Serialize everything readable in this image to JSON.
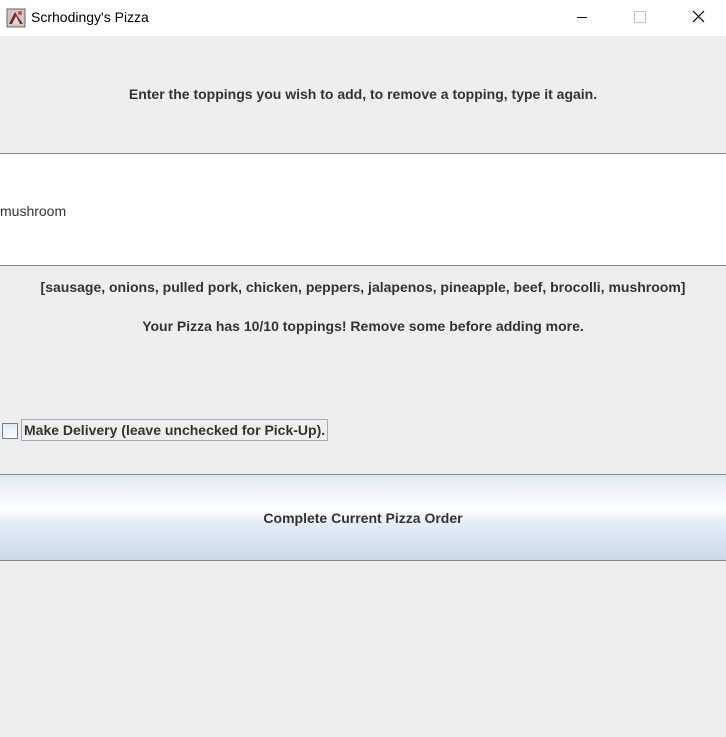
{
  "window": {
    "title": "Scrhodingy's Pizza",
    "controls": {
      "minimize": "minimize-icon",
      "maximize": "maximize-icon",
      "close": "close-icon"
    }
  },
  "instructions": "Enter the toppings you wish to add, to remove a topping, type it again.",
  "topping_input": {
    "value": "mushroom"
  },
  "toppings_list": "[sausage, onions, pulled pork, chicken, peppers, jalapenos, pineapple, beef, brocolli, mushroom]",
  "status_message": "Your Pizza has 10/10 toppings! Remove some before adding more.",
  "delivery": {
    "label": "Make Delivery (leave unchecked for Pick-Up).",
    "checked": false
  },
  "complete_button": {
    "label": "Complete Current Pizza Order"
  },
  "colors": {
    "background": "#eeeeee",
    "text": "#333333",
    "border": "#7a8a99"
  }
}
